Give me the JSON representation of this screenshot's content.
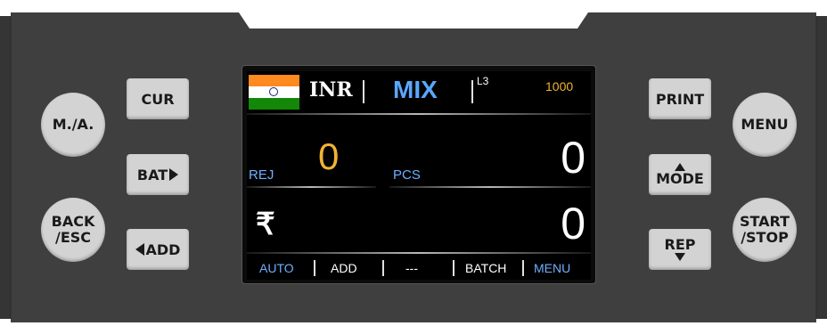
{
  "colors": {
    "panel": "#3f3f3f",
    "button": "#d3d3d3",
    "screen_bg": "#000000",
    "amber": "#f2b233",
    "blue": "#5aa7ff"
  },
  "left_buttons": {
    "ma": "M./A.",
    "cur": "CUR",
    "bat": "BAT",
    "back_line1": "BACK",
    "back_line2": "/ESC",
    "add": "ADD"
  },
  "right_buttons": {
    "print": "PRINT",
    "menu": "MENU",
    "mode": "MODE",
    "rep": "REP",
    "start_line1": "START",
    "start_line2": "/STOP"
  },
  "display": {
    "flag_icon": "india-flag-icon",
    "currency": "INR",
    "mode": "MIX",
    "level": "L3",
    "batch_value": "1000",
    "rej_label": "REJ",
    "rej_value": "0",
    "pcs_label": "PCS",
    "pcs_value": "0",
    "rupee_symbol": "₹",
    "amount_value": "0",
    "menu_items": [
      "AUTO",
      "ADD",
      "---",
      "BATCH",
      "MENU"
    ]
  }
}
